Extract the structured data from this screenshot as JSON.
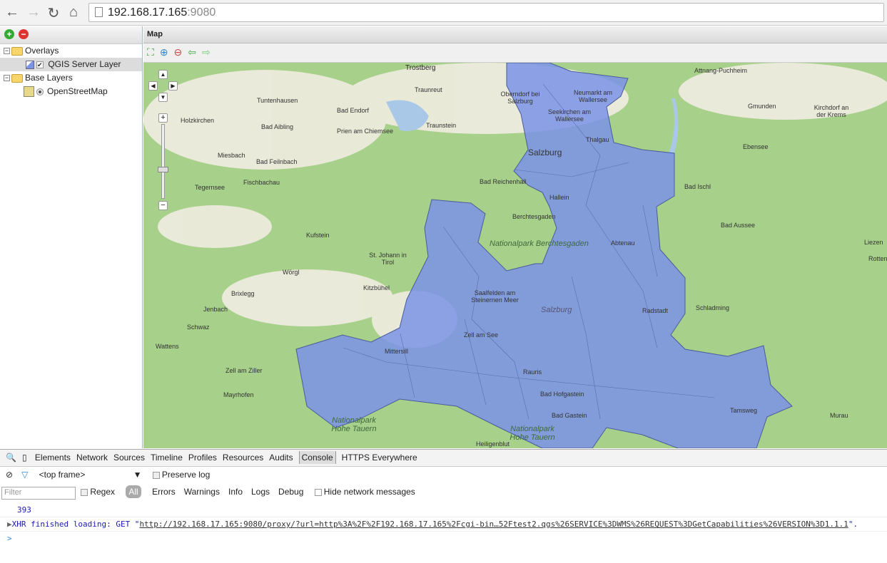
{
  "browser": {
    "url_host": "192.168.17.165",
    "url_port": ":9080"
  },
  "tree": {
    "overlays": "Overlays",
    "overlay_layer": "QGIS Server Layer",
    "base_layers": "Base Layers",
    "base_layer": "OpenStreetMap"
  },
  "map": {
    "title": "Map",
    "places": [
      "Trostberg",
      "Attnang-Puchheim",
      "Traunreut",
      "Oberndorf bei Salzburg",
      "Neumarkt am Wallersee",
      "Tuntenhausen",
      "Bad Endorf",
      "Seekirchen am Wallersee",
      "Gmunden",
      "Kirchdorf an der Krems",
      "Holzkirchen",
      "Bad Aibling",
      "Prien am Chiemsee",
      "Traunstein",
      "Thalgau",
      "Miesbach",
      "Salzburg",
      "Ebensee",
      "Bad Feilnbach",
      "Fischbachau",
      "Bad Reichenhall",
      "Hallein",
      "Tegernsee",
      "Bad Ischl",
      "Berchtesgaden",
      "Kufstein",
      "Bad Aussee",
      "Abtenau",
      "St. Johann in Tirol",
      "Liezen",
      "Wörgl",
      "Brixlegg",
      "Kitzbühel",
      "Saalfelden am Steinernen Meer",
      "Jenbach",
      "Radstadt",
      "Schladming",
      "Schwaz",
      "Zell am See",
      "Wattens",
      "Mittersill",
      "Rauris",
      "Zell am Ziller",
      "Bad Hofgastein",
      "Mayrhofen",
      "Bad Gastein",
      "Tamsweg",
      "Murau",
      "Heiligenblut",
      "Rotten"
    ],
    "parks": [
      "Nationalpark Berchtesgaden",
      "Nationalpark Hohe Tauern",
      "Nationalpark Hohe Tauern"
    ],
    "region_label": "Salzburg",
    "colors": {
      "land": "#a7d08a",
      "overlay": "#7b93e6",
      "water": "#a9c8e8"
    }
  },
  "devtools": {
    "tabs": [
      "Elements",
      "Network",
      "Sources",
      "Timeline",
      "Profiles",
      "Resources",
      "Audits",
      "Console",
      "HTTPS Everywhere"
    ],
    "frame": "<top frame>",
    "preserve": "Preserve log",
    "filter_placeholder": "Filter",
    "regex": "Regex",
    "levels": [
      "All",
      "Errors",
      "Warnings",
      "Info",
      "Logs",
      "Debug"
    ],
    "hide_network": "Hide network messages",
    "log_value": "393",
    "xhr_prefix": "XHR finished loading: GET \"",
    "xhr_url": "http://192.168.17.165:9080/proxy/?url=http%3A%2F%2F192.168.17.165%2Fcgi-bin…52Ftest2.qgs%26SERVICE%3DWMS%26REQUEST%3DGetCapabilities%26VERSION%3D1.1.1",
    "xhr_suffix": "\".",
    "prompt": ">"
  }
}
